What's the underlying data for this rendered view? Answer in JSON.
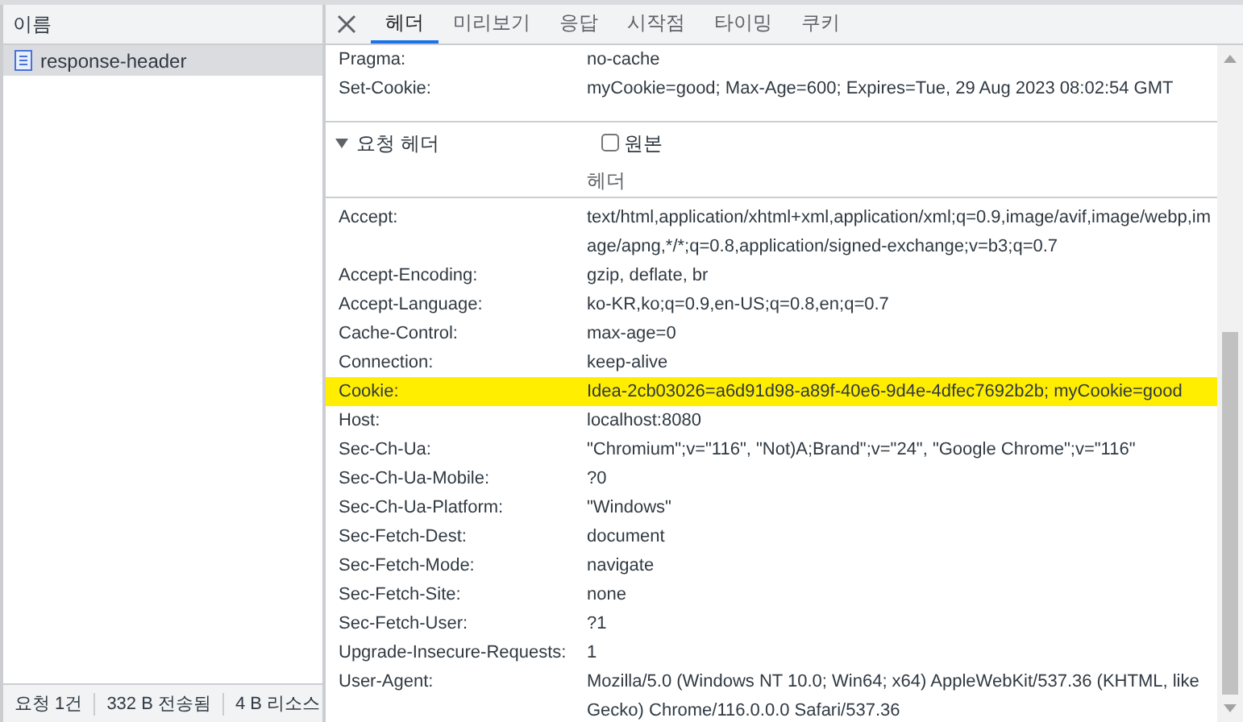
{
  "sidebar": {
    "column_header": "이름",
    "items": [
      {
        "name": "response-header",
        "selected": true
      }
    ]
  },
  "status_bar": [
    "요청 1건",
    "332 B 전송됨",
    "4 B 리소스"
  ],
  "tabs": [
    {
      "label": "헤더",
      "selected": true
    },
    {
      "label": "미리보기",
      "selected": false
    },
    {
      "label": "응답",
      "selected": false
    },
    {
      "label": "시작점",
      "selected": false
    },
    {
      "label": "타이밍",
      "selected": false
    },
    {
      "label": "쿠키",
      "selected": false
    }
  ],
  "response_headers": [
    {
      "name": "Pragma:",
      "value": "no-cache",
      "highlighted": false
    },
    {
      "name": "Set-Cookie:",
      "value": "myCookie=good; Max-Age=600; Expires=Tue, 29 Aug 2023 08:02:54 GMT",
      "highlighted": false
    }
  ],
  "request_section": {
    "title": "요청 헤더",
    "expanded": true,
    "raw": {
      "label": "원본",
      "checked": false
    },
    "column_header": "헤더",
    "headers": [
      {
        "name": "Accept:",
        "value": "text/html,application/xhtml+xml,application/xml;q=0.9,image/avif,image/webp,image/apng,*/*;q=0.8,application/signed-exchange;v=b3;q=0.7",
        "highlighted": false
      },
      {
        "name": "Accept-Encoding:",
        "value": "gzip, deflate, br",
        "highlighted": false
      },
      {
        "name": "Accept-Language:",
        "value": "ko-KR,ko;q=0.9,en-US;q=0.8,en;q=0.7",
        "highlighted": false
      },
      {
        "name": "Cache-Control:",
        "value": "max-age=0",
        "highlighted": false
      },
      {
        "name": "Connection:",
        "value": "keep-alive",
        "highlighted": false
      },
      {
        "name": "Cookie:",
        "value": "Idea-2cb03026=a6d91d98-a89f-40e6-9d4e-4dfec7692b2b; myCookie=good",
        "highlighted": true
      },
      {
        "name": "Host:",
        "value": "localhost:8080",
        "highlighted": false
      },
      {
        "name": "Sec-Ch-Ua:",
        "value": "\"Chromium\";v=\"116\", \"Not)A;Brand\";v=\"24\", \"Google Chrome\";v=\"116\"",
        "highlighted": false
      },
      {
        "name": "Sec-Ch-Ua-Mobile:",
        "value": "?0",
        "highlighted": false
      },
      {
        "name": "Sec-Ch-Ua-Platform:",
        "value": "\"Windows\"",
        "highlighted": false
      },
      {
        "name": "Sec-Fetch-Dest:",
        "value": "document",
        "highlighted": false
      },
      {
        "name": "Sec-Fetch-Mode:",
        "value": "navigate",
        "highlighted": false
      },
      {
        "name": "Sec-Fetch-Site:",
        "value": "none",
        "highlighted": false
      },
      {
        "name": "Sec-Fetch-User:",
        "value": "?1",
        "highlighted": false
      },
      {
        "name": "Upgrade-Insecure-Requests:",
        "value": "1",
        "highlighted": false
      },
      {
        "name": "User-Agent:",
        "value": "Mozilla/5.0 (Windows NT 10.0; Win64; x64) AppleWebKit/537.36 (KHTML, like Gecko) Chrome/116.0.0.0 Safari/537.36",
        "highlighted": false
      }
    ]
  }
}
